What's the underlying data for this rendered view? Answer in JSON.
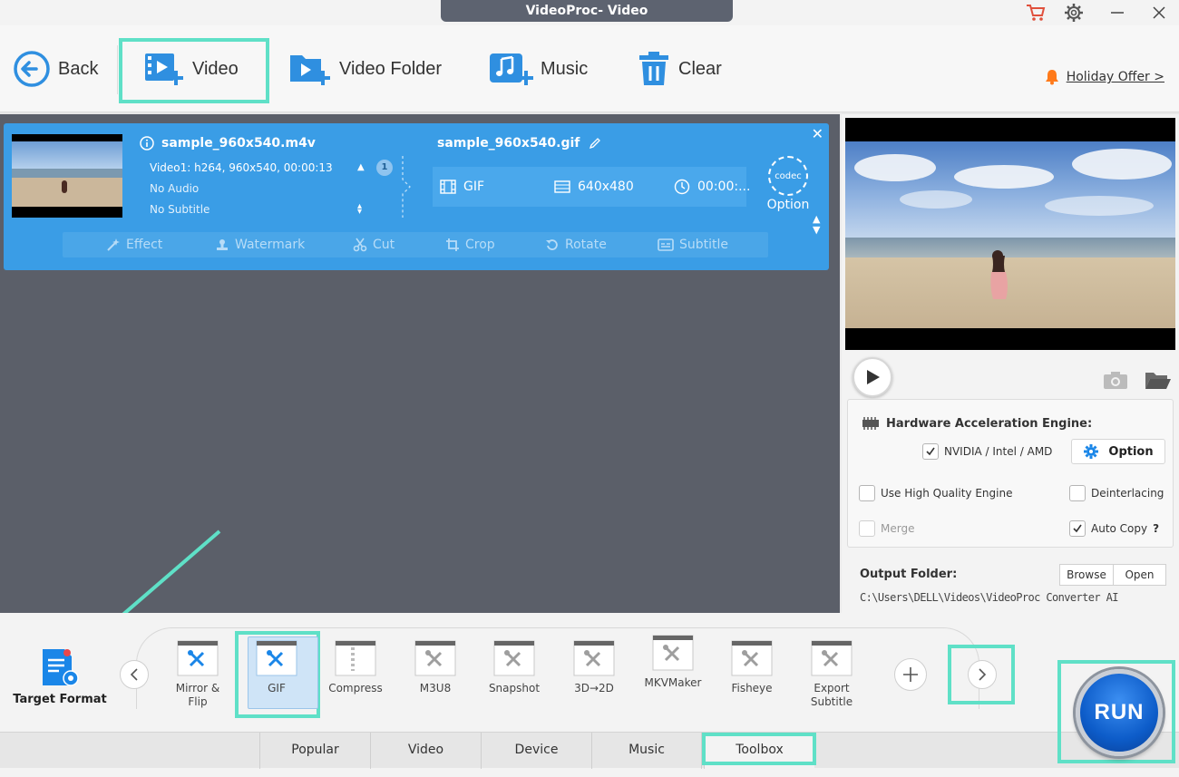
{
  "window": {
    "title": "VideoProc- Video"
  },
  "toolbar": {
    "back_label": "Back",
    "video_label": "Video",
    "video_folder_label": "Video Folder",
    "music_label": "Music",
    "clear_label": "Clear",
    "offer_label": "Holiday Offer >"
  },
  "task": {
    "source_name": "sample_960x540.m4v",
    "video_info": "Video1: h264, 960x540, 00:00:13",
    "audio_info": "No Audio",
    "subtitle_info": "No Subtitle",
    "track_count": "1",
    "output_name": "sample_960x540.gif",
    "output_format": "GIF",
    "output_resolution": "640x480",
    "output_duration": "00:00:...",
    "codec_badge": "codec",
    "option_label": "Option",
    "edit_tools": [
      "Effect",
      "Watermark",
      "Cut",
      "Crop",
      "Rotate",
      "Subtitle"
    ]
  },
  "hardware": {
    "title": "Hardware Acceleration Engine:",
    "nvidia_label": "NVIDIA / Intel / AMD",
    "option_label": "Option",
    "high_quality_label": "Use High Quality Engine",
    "deinterlacing_label": "Deinterlacing",
    "merge_label": "Merge",
    "auto_copy_label": "Auto Copy",
    "help_label": "?"
  },
  "output": {
    "label": "Output Folder:",
    "browse_label": "Browse",
    "open_label": "Open",
    "path": "C:\\Users\\DELL\\Videos\\VideoProc Converter AI"
  },
  "format_bar": {
    "target_format_label": "Target Format",
    "items": [
      {
        "label_line1": "Mirror &",
        "label_line2": "Flip"
      },
      {
        "label_line1": "GIF",
        "label_line2": ""
      },
      {
        "label_line1": "Compress",
        "label_line2": ""
      },
      {
        "label_line1": "M3U8",
        "label_line2": ""
      },
      {
        "label_line1": "Snapshot",
        "label_line2": ""
      },
      {
        "label_line1": "3D→2D",
        "label_line2": ""
      },
      {
        "label_line1": "MKVMaker",
        "label_line2": ""
      },
      {
        "label_line1": "Fisheye",
        "label_line2": ""
      },
      {
        "label_line1": "Export",
        "label_line2": "Subtitle"
      }
    ],
    "selected": "GIF",
    "tabs": [
      "Popular",
      "Video",
      "Device",
      "Music",
      "Toolbox"
    ],
    "active_tab": "Toolbox",
    "run_label": "RUN"
  },
  "colors": {
    "accent": "#3a9de6",
    "highlight": "#5fe0c7",
    "workarea": "#5b5f69",
    "cart": "#e0503c",
    "bell": "#ff7a1a"
  }
}
